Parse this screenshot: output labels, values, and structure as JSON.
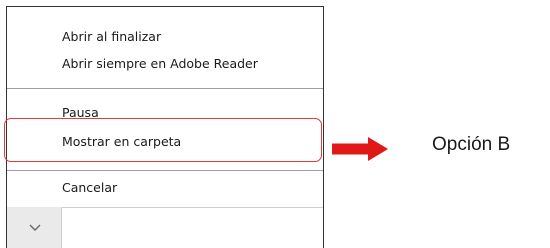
{
  "menu": {
    "items": [
      {
        "label": "Abrir al finalizar"
      },
      {
        "label": "Abrir siempre en Adobe Reader"
      },
      {
        "label": "Pausa"
      },
      {
        "label": "Mostrar en carpeta"
      },
      {
        "label": "Cancelar"
      }
    ]
  },
  "annotation": {
    "label": "Opción B",
    "arrow_color": "#e01818",
    "highlight_color": "#e03a3a"
  },
  "icons": {
    "dropdown": "chevron-down-icon",
    "pointer": "right-arrow-icon"
  }
}
